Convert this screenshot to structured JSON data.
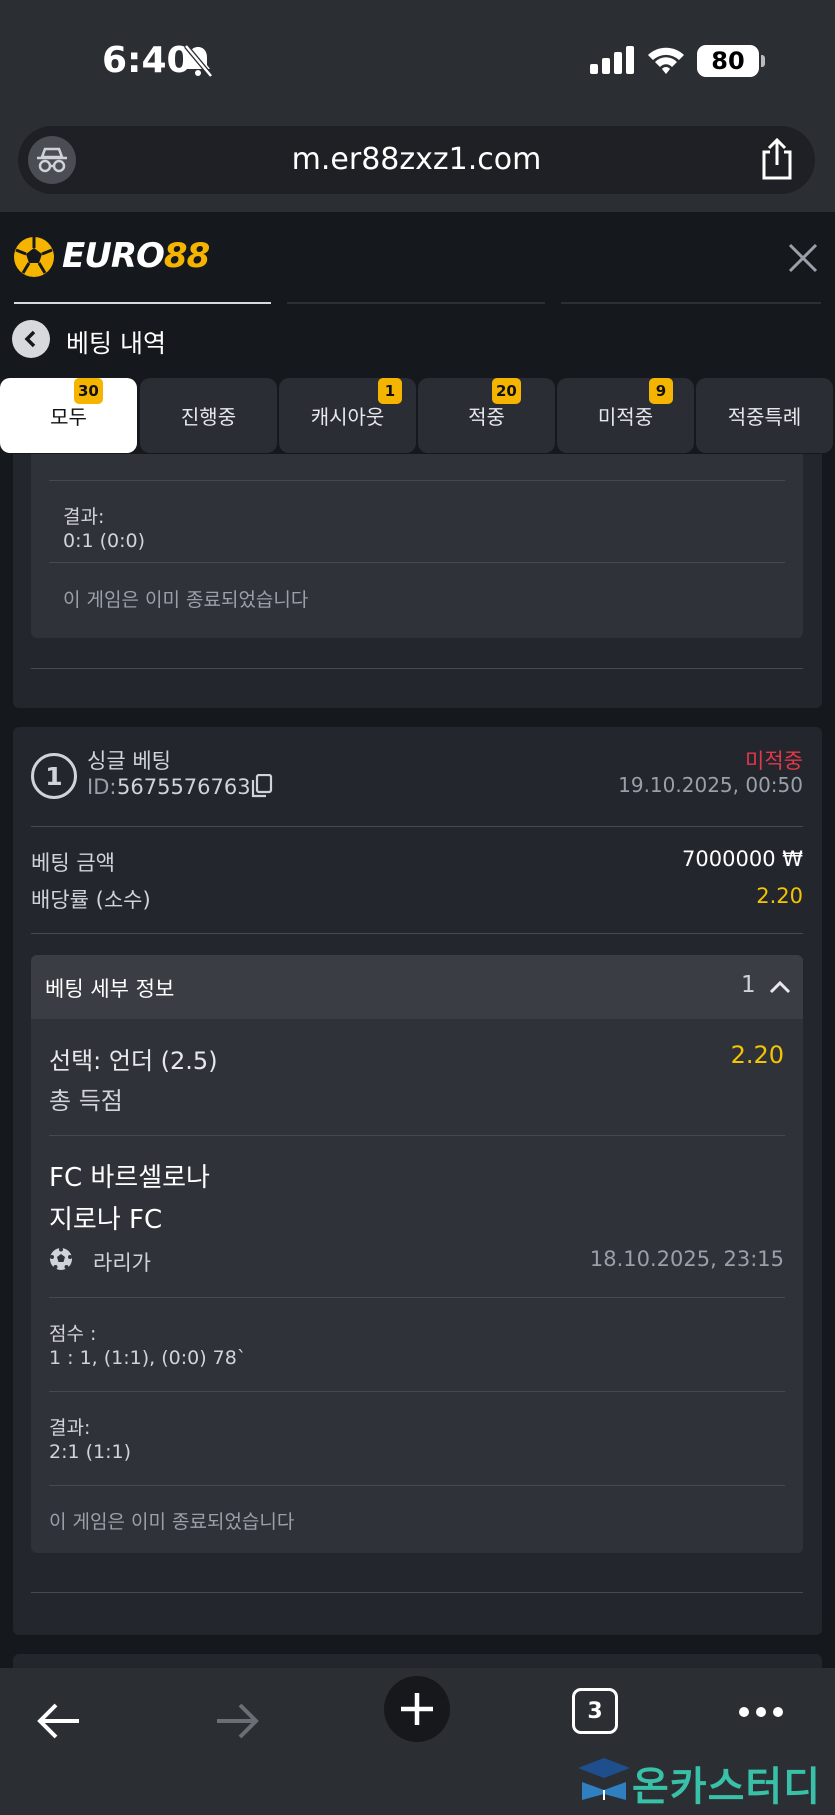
{
  "status_bar": {
    "time": "6:40",
    "battery": "80"
  },
  "browser": {
    "url": "m.er88zxz1.com",
    "open_tabs": "3"
  },
  "site": {
    "logo_prefix": "EURO",
    "logo_suffix": "88"
  },
  "page": {
    "title": "베팅 내역"
  },
  "tabs": [
    {
      "label": "모두",
      "badge": "30",
      "active": true
    },
    {
      "label": "진행중",
      "badge": ""
    },
    {
      "label": "캐시아웃",
      "badge": "1"
    },
    {
      "label": "적중",
      "badge": "20"
    },
    {
      "label": "미적중",
      "badge": "9"
    },
    {
      "label": "적중특례",
      "badge": ""
    }
  ],
  "prev_card": {
    "result_label": "결과:",
    "result_value": "0:1 (0:0)",
    "finished_note": "이 게임은 이미 종료되었습니다"
  },
  "bet_card": {
    "index": "1",
    "type": "싱글 베팅",
    "id_label": "ID:",
    "id_value": "5675576763",
    "status": "미적중",
    "datetime": "19.10.2025, 00:50",
    "stake_label": "베팅 금액",
    "stake_value": "7000000 ₩",
    "odds_label": "배당률 (소수)",
    "odds_value": "2.20",
    "details_title": "베팅 세부 정보",
    "details_count": "1",
    "selection": "선택: 언더 (2.5)",
    "selection_odds": "2.20",
    "market": "총 득점",
    "home_team": "FC 바르셀로나",
    "away_team": "지로나 FC",
    "league": "라리가",
    "event_datetime": "18.10.2025, 23:15",
    "score_label": "점수 :",
    "score_value": "1 : 1, (1:1), (0:0) 78`",
    "result_label": "결과:",
    "result_value": "2:1 (1:1)",
    "finished_note": "이 게임은 이미 종료되었습니다"
  },
  "watermark": "온카스터디"
}
